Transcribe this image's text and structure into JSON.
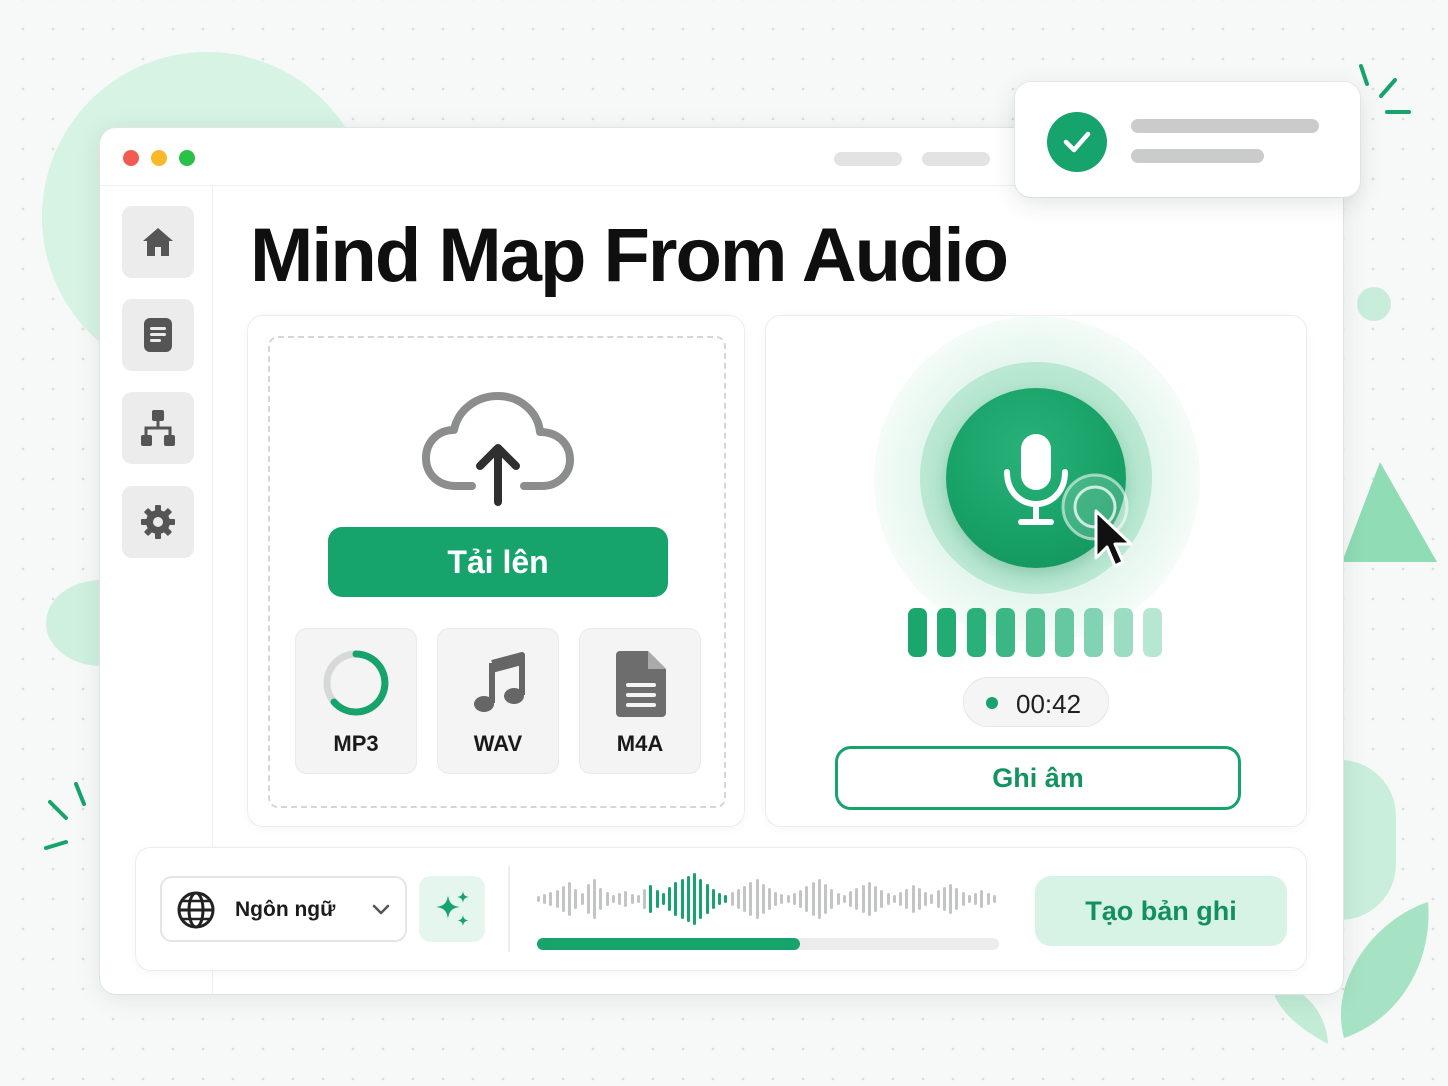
{
  "app": {
    "title": "Mind Map From Audio"
  },
  "sidebar": {
    "items": [
      {
        "name": "home",
        "icon": "home-icon"
      },
      {
        "name": "documents",
        "icon": "document-icon"
      },
      {
        "name": "mind-map",
        "icon": "hierarchy-icon"
      },
      {
        "name": "settings",
        "icon": "gear-icon"
      }
    ]
  },
  "upload": {
    "icon": "cloud-upload-icon",
    "button_label": "Tải lên",
    "formats": [
      {
        "label": "MP3",
        "icon": "progress-ring-icon"
      },
      {
        "label": "WAV",
        "icon": "music-note-icon"
      },
      {
        "label": "M4A",
        "icon": "file-icon"
      }
    ]
  },
  "recorder": {
    "icon": "microphone-icon",
    "level_bars": 9,
    "timer": "00:42",
    "button_label": "Ghi âm"
  },
  "bottom_bar": {
    "language_label": "Ngôn ngữ",
    "language_icon": "globe-icon",
    "ai_icon": "sparkles-icon",
    "playback_progress": 0.57,
    "create_label": "Tạo bản ghi"
  },
  "toast": {
    "icon": "check-icon",
    "status": "success"
  },
  "colors": {
    "accent": "#17a36c",
    "accent_light": "#d6f3e6",
    "traffic_red": "#f35b52",
    "traffic_yellow": "#f7b928",
    "traffic_green": "#27c247"
  }
}
